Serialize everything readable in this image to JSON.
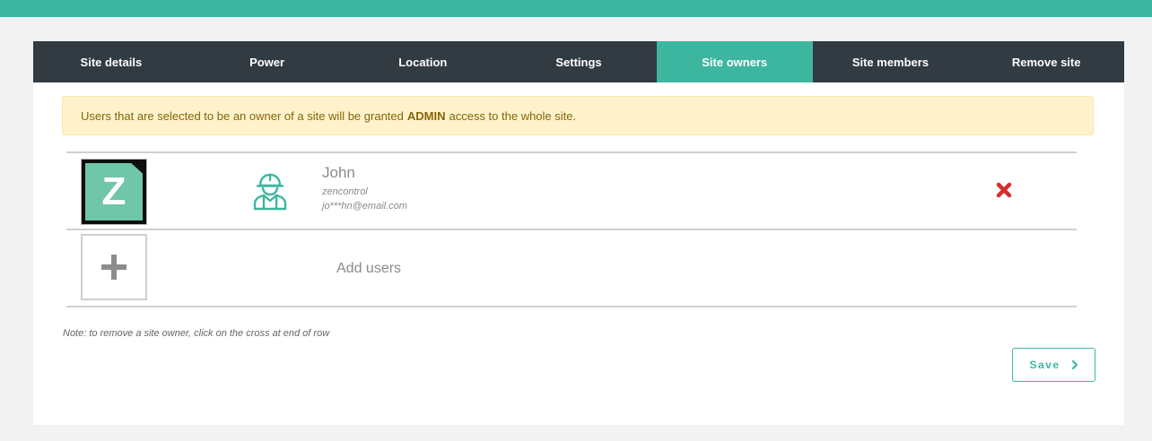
{
  "tabs": [
    {
      "label": "Site details"
    },
    {
      "label": "Power"
    },
    {
      "label": "Location"
    },
    {
      "label": "Settings"
    },
    {
      "label": "Site owners"
    },
    {
      "label": "Site members"
    },
    {
      "label": "Remove site"
    }
  ],
  "active_tab": "Site owners",
  "notice": {
    "before": "Users that are selected to be an owner of a site will be granted",
    "strong": "ADMIN",
    "after": "access to the whole site."
  },
  "owners": [
    {
      "logo_letter": "Z",
      "name": "John",
      "company": "zencontrol",
      "email": "jo***hn@email.com",
      "role_icon": "construction-worker-icon",
      "remove_icon": "red-cross-icon"
    }
  ],
  "add_users": {
    "label": "Add users",
    "icon": "plus-icon"
  },
  "note": "Note: to remove a site owner, click on the cross at end of row",
  "save": {
    "label": "Save",
    "icon": "chevron-right-icon"
  },
  "colors": {
    "accent": "#3db6a0",
    "tab_bar": "#323a42",
    "notice_bg": "#fff3cd",
    "notice_text": "#856404",
    "remove": "#d32f2f"
  }
}
